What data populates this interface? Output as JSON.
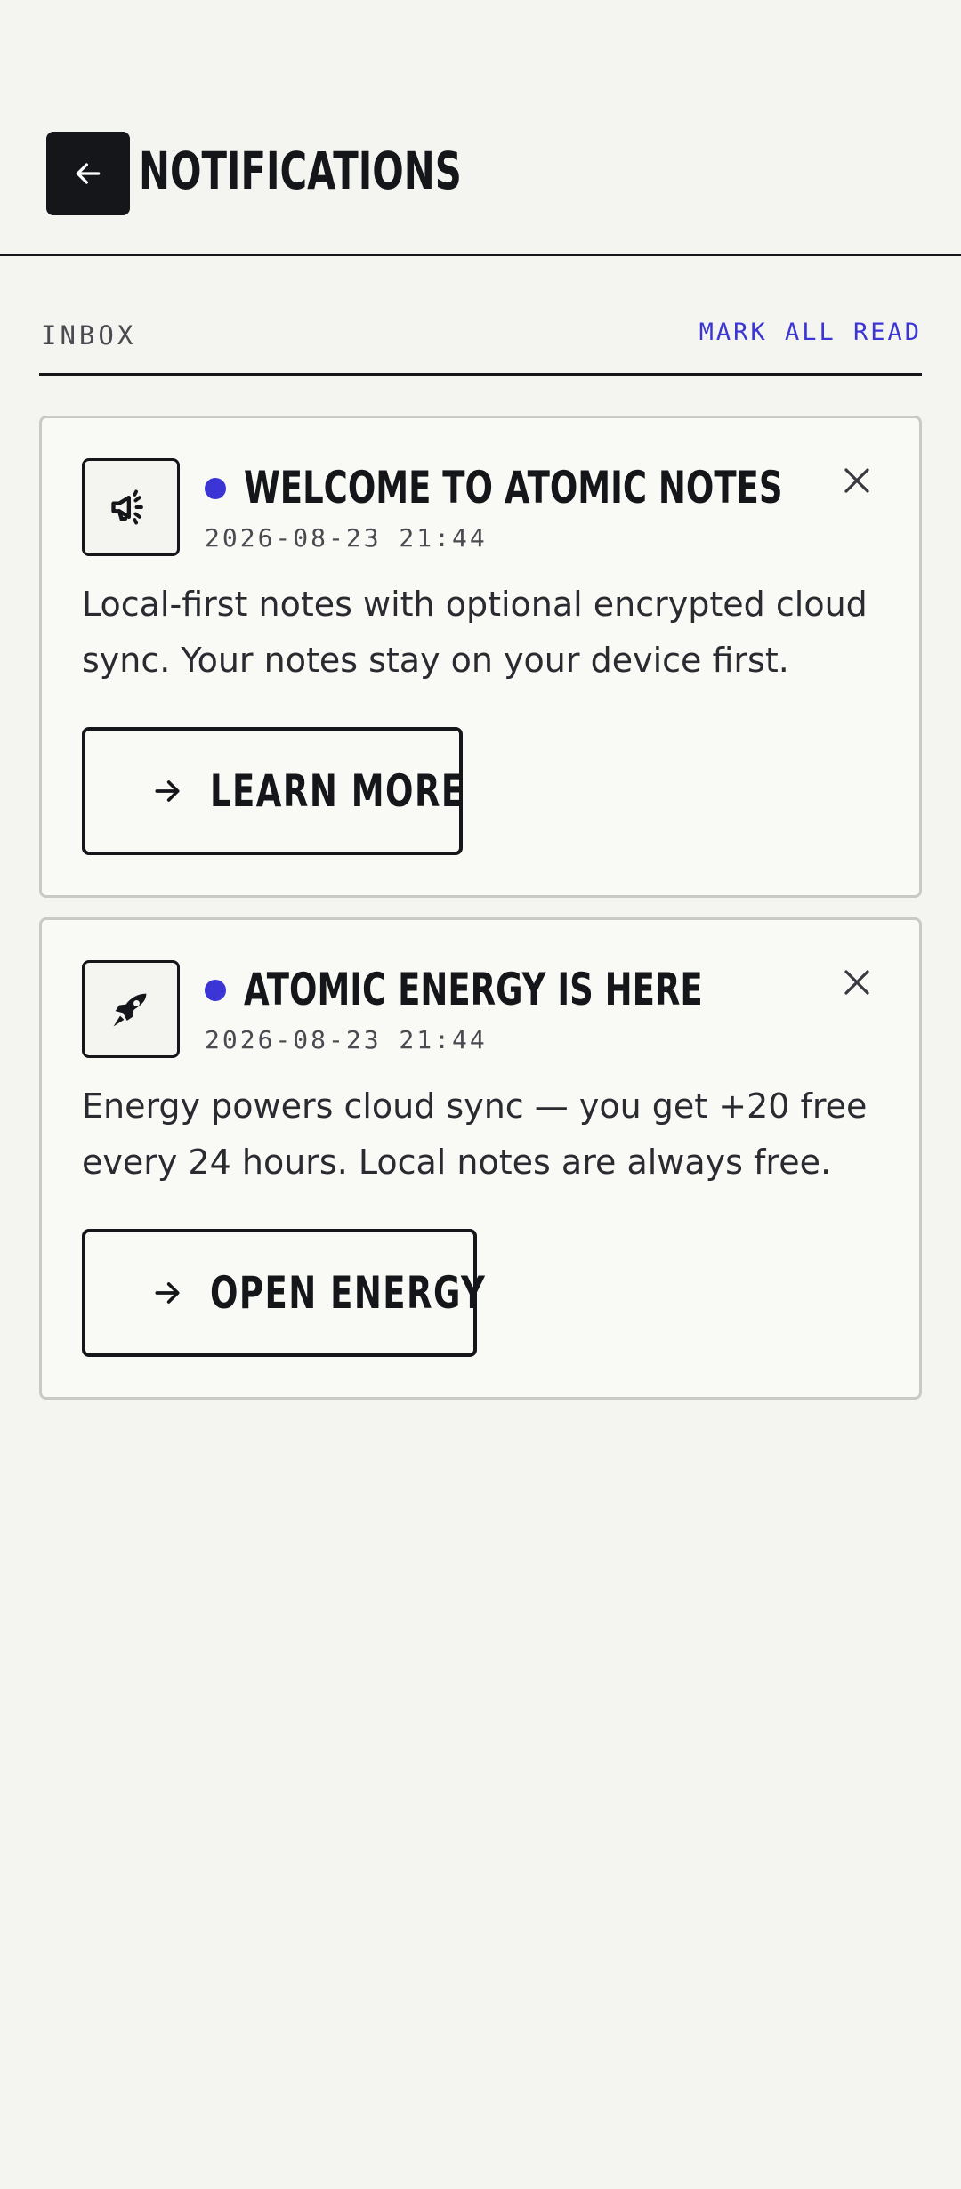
{
  "header": {
    "title": "NOTIFICATIONS",
    "back_icon": "arrow-left-icon"
  },
  "section": {
    "label": "INBOX",
    "mark_all_read": "MARK ALL READ"
  },
  "colors": {
    "accent": "#3b35d6",
    "ink": "#15161a",
    "background": "#f4f4f0",
    "card_background": "#f9f9f5"
  },
  "notifications": [
    {
      "icon": "megaphone-icon",
      "unread": true,
      "title": "WELCOME TO ATOMIC NOTES",
      "timestamp": "2026-08-23 21:44",
      "body": "Local-first notes with optional encrypted cloud sync. Your notes stay on your device first.",
      "action_label": "LEARN MORE"
    },
    {
      "icon": "rocket-icon",
      "unread": true,
      "title": "ATOMIC ENERGY IS HERE",
      "timestamp": "2026-08-23 21:44",
      "body": "Energy powers cloud sync — you get +20 free every 24 hours. Local notes are always free.",
      "action_label": "OPEN ENERGY"
    }
  ]
}
